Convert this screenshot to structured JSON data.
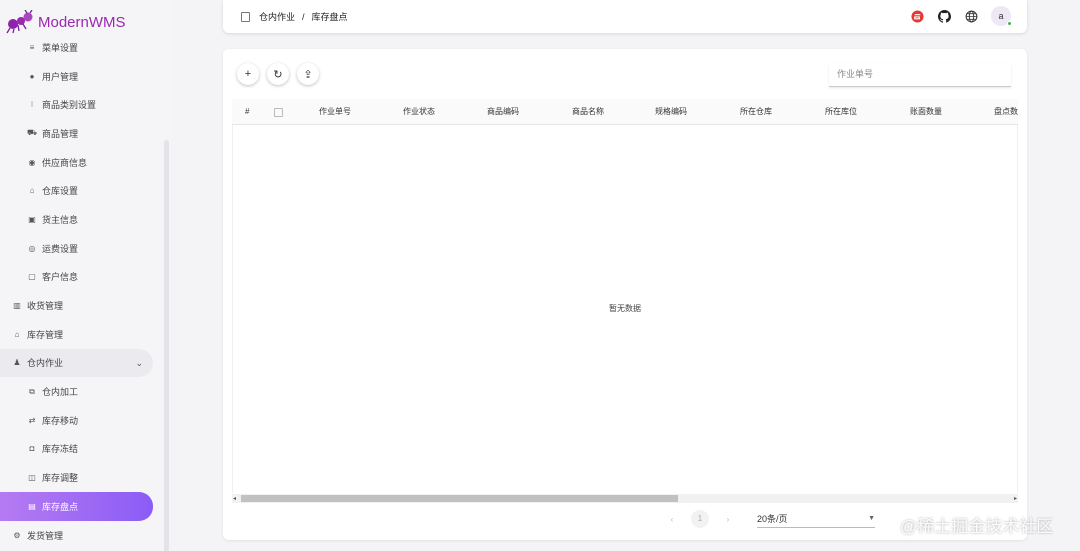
{
  "app": {
    "title": "ModernWMS"
  },
  "sidebar": {
    "items": [
      {
        "label": "菜单设置",
        "icon": "list-icon",
        "level": "sub"
      },
      {
        "label": "用户管理",
        "icon": "user-icon",
        "level": "sub"
      },
      {
        "label": "商品类别设置",
        "icon": "category-icon",
        "level": "sub"
      },
      {
        "label": "商品管理",
        "icon": "cart-icon",
        "level": "sub"
      },
      {
        "label": "供应商信息",
        "icon": "supplier-icon",
        "level": "sub"
      },
      {
        "label": "仓库设置",
        "icon": "warehouse-icon",
        "level": "sub"
      },
      {
        "label": "货主信息",
        "icon": "owner-icon",
        "level": "sub"
      },
      {
        "label": "运费设置",
        "icon": "freight-icon",
        "level": "sub"
      },
      {
        "label": "客户信息",
        "icon": "customer-icon",
        "level": "sub"
      },
      {
        "label": "收货管理",
        "icon": "receiving-icon",
        "level": "top"
      },
      {
        "label": "库存管理",
        "icon": "inventory-icon",
        "level": "top"
      },
      {
        "label": "仓内作业",
        "icon": "worker-icon",
        "level": "top",
        "open": true
      },
      {
        "label": "仓内加工",
        "icon": "processing-icon",
        "level": "sub"
      },
      {
        "label": "库存移动",
        "icon": "move-icon",
        "level": "sub"
      },
      {
        "label": "库存冻结",
        "icon": "lock-icon",
        "level": "sub"
      },
      {
        "label": "库存调整",
        "icon": "adjust-icon",
        "level": "sub"
      },
      {
        "label": "库存盘点",
        "icon": "stocktake-icon",
        "level": "sub",
        "active": true
      },
      {
        "label": "发货管理",
        "icon": "shipping-icon",
        "level": "top"
      }
    ]
  },
  "header": {
    "breadcrumb": [
      "仓内作业",
      "库存盘点"
    ],
    "separator": "/",
    "avatar_letter": "a",
    "icons": [
      "gitee-icon",
      "github-icon",
      "globe-icon"
    ]
  },
  "toolbar": {
    "add_label": "+",
    "refresh_label": "↻",
    "export_label": "⇪"
  },
  "search": {
    "placeholder": "作业单号"
  },
  "table": {
    "columns": [
      "#",
      "",
      "作业单号",
      "作业状态",
      "商品编码",
      "商品名称",
      "规格编码",
      "所在仓库",
      "所在库位",
      "账面数量",
      "盘点数量"
    ],
    "empty_text": "暂无数据"
  },
  "pagination": {
    "prev": "‹",
    "current": "1",
    "next": "›",
    "page_size": "20条/页"
  },
  "watermark": "@稀土掘金技术社区",
  "colors": {
    "accent": "#9c27b0",
    "active_from": "#b57bf2",
    "active_to": "#8b5cf6"
  }
}
